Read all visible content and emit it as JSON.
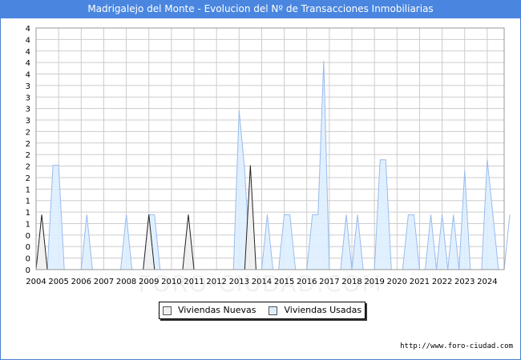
{
  "title": "Madrigalejo del Monte - Evolucion del Nº de Transacciones Inmobiliarias",
  "source": "http://www.foro-ciudad.com",
  "watermark": "FORO-CIUDAD.COM",
  "colors": {
    "title_bg": "#4a86e0",
    "nuevas_fill": "#f0f0f0",
    "nuevas_stroke": "#222222",
    "usadas_fill": "#ddeeff",
    "usadas_stroke": "#99bbee",
    "grid": "#cccccc"
  },
  "chart_data": {
    "type": "area",
    "xlabel": "",
    "ylabel": "",
    "x_ticks": [
      "2004",
      "2005",
      "2006",
      "2007",
      "2008",
      "2009",
      "2010",
      "2011",
      "2012",
      "2013",
      "2014",
      "2015",
      "2016",
      "2017",
      "2018",
      "2019",
      "2020",
      "2021",
      "2022",
      "2023",
      "2024"
    ],
    "y_tick_labels": [
      "0",
      "0",
      "0",
      "0",
      "1",
      "1",
      "1",
      "1",
      "2",
      "2",
      "2",
      "2",
      "2",
      "3",
      "3",
      "3",
      "3",
      "4",
      "4",
      "4",
      "4",
      "4"
    ],
    "ylim": [
      0,
      4.4
    ],
    "x_unit": "quarter",
    "x_start": "2004 Q1",
    "grid": true,
    "legend_position": "bottom-center",
    "series": [
      {
        "name": "Viviendas Nuevas",
        "values": [
          0,
          1,
          0,
          0,
          0,
          0,
          0,
          0,
          0,
          0,
          0,
          0,
          0,
          0,
          0,
          0,
          0,
          0,
          0,
          0,
          1,
          0,
          0,
          0,
          0,
          0,
          0,
          1,
          0,
          0,
          0,
          0,
          0,
          0,
          0,
          0,
          0,
          0,
          1.9,
          0,
          0,
          0,
          0,
          0,
          0,
          0,
          0,
          0,
          0,
          0,
          0,
          0,
          0,
          0,
          0,
          0,
          0,
          0,
          0,
          0,
          0,
          0,
          0,
          0,
          0,
          0,
          0,
          0,
          0,
          0,
          0,
          0,
          0,
          0,
          0,
          0,
          0,
          0,
          0,
          0,
          0,
          0,
          0,
          0
        ]
      },
      {
        "name": "Viviendas Usadas",
        "values": [
          0,
          0,
          0,
          1.9,
          1.9,
          0,
          0,
          0,
          0,
          1,
          0,
          0,
          0,
          0,
          0,
          0,
          1,
          0,
          0,
          0,
          1,
          1,
          0,
          0,
          0,
          0,
          0,
          0,
          0,
          0,
          0,
          0,
          0,
          0,
          0,
          0,
          2.9,
          1.8,
          0,
          0,
          0,
          1,
          0,
          0,
          1,
          1,
          0,
          0,
          0,
          1,
          1,
          3.8,
          0,
          0,
          0,
          1,
          0,
          1,
          0,
          0,
          0,
          2,
          2,
          0,
          0,
          0,
          1,
          1,
          0,
          0,
          1,
          0,
          1,
          0,
          1,
          0,
          1.8,
          0,
          0,
          0,
          2,
          1,
          0,
          0,
          1
        ]
      }
    ]
  }
}
